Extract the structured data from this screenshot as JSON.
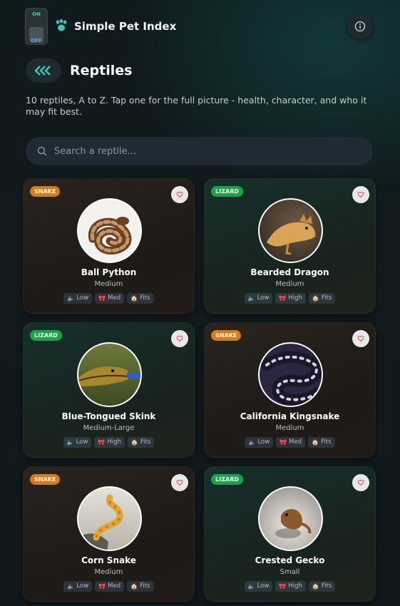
{
  "header": {
    "toggle": {
      "on": "ON",
      "off": "OFF"
    },
    "app_title": "Simple Pet Index",
    "info_icon": "info-icon"
  },
  "page": {
    "title": "Reptiles",
    "subtitle": "10 reptiles, A to Z. Tap one for the full picture - health, character, and who it may fit best."
  },
  "search": {
    "placeholder": "Search a reptile..."
  },
  "colors": {
    "snake_badge": "#d97b10",
    "lizard_badge": "#17a54b",
    "accent": "#37c9b6"
  },
  "cards": [
    {
      "badge": "SNAKE",
      "name": "Ball Python",
      "size": "Medium",
      "chips": [
        "Low",
        "Med",
        "Fits"
      ]
    },
    {
      "badge": "LIZARD",
      "name": "Bearded Dragon",
      "size": "Medium",
      "chips": [
        "Low",
        "High",
        "Fits"
      ]
    },
    {
      "badge": "LIZARD",
      "name": "Blue-Tongued Skink",
      "size": "Medium-Large",
      "chips": [
        "Low",
        "High",
        "Fits"
      ]
    },
    {
      "badge": "SNAKE",
      "name": "California Kingsnake",
      "size": "Medium",
      "chips": [
        "Low",
        "Med",
        "Fits"
      ]
    },
    {
      "badge": "SNAKE",
      "name": "Corn Snake",
      "size": "Medium",
      "chips": [
        "Low",
        "Med",
        "Fits"
      ]
    },
    {
      "badge": "LIZARD",
      "name": "Crested Gecko",
      "size": "Small",
      "chips": [
        "Low",
        "High",
        "Fits"
      ]
    }
  ]
}
